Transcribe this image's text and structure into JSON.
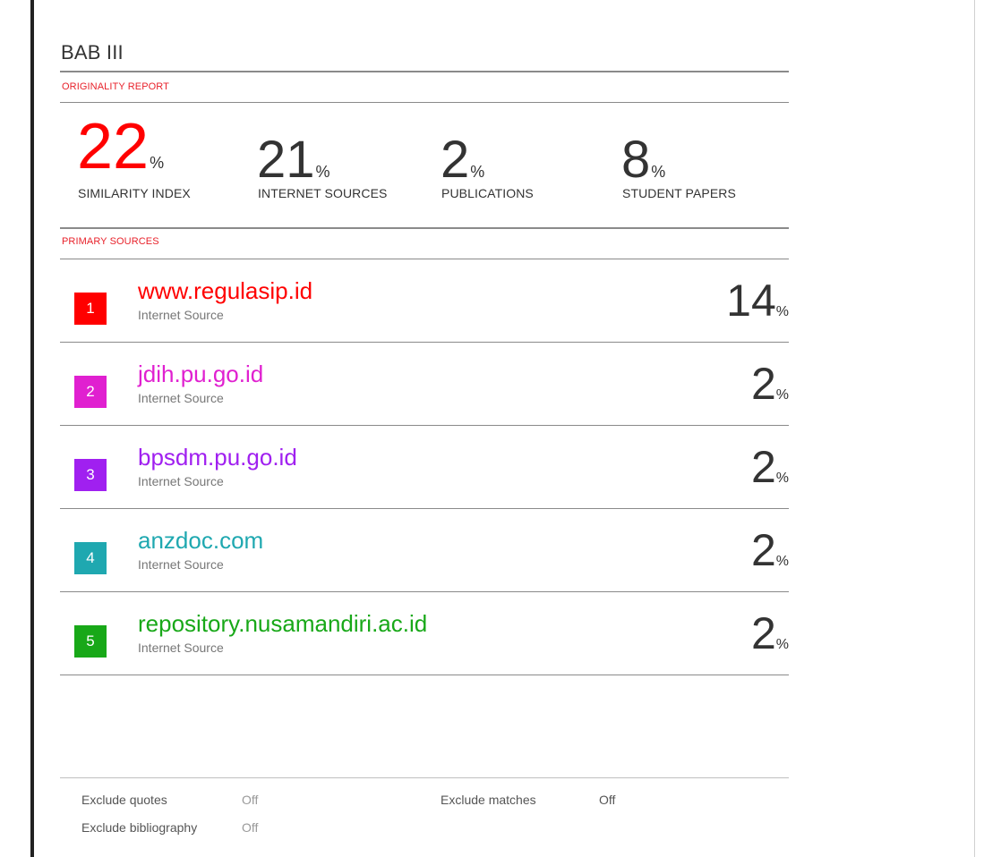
{
  "report": {
    "title": "BAB III",
    "originality_label": "ORIGINALITY REPORT",
    "primary_sources_label": "PRIMARY SOURCES"
  },
  "stats": [
    {
      "value": "22",
      "unit": "%",
      "label": "SIMILARITY INDEX"
    },
    {
      "value": "21",
      "unit": "%",
      "label": "INTERNET SOURCES"
    },
    {
      "value": "2",
      "unit": "%",
      "label": "PUBLICATIONS"
    },
    {
      "value": "8",
      "unit": "%",
      "label": "STUDENT PAPERS"
    }
  ],
  "sources": [
    {
      "index": "1",
      "name": "www.regulasip.id",
      "type": "Internet Source",
      "percent": "14",
      "unit": "%",
      "color": "#ff0000"
    },
    {
      "index": "2",
      "name": "jdih.pu.go.id",
      "type": "Internet Source",
      "percent": "2",
      "unit": "%",
      "color": "#e020d0"
    },
    {
      "index": "3",
      "name": "bpsdm.pu.go.id",
      "type": "Internet Source",
      "percent": "2",
      "unit": "%",
      "color": "#a020f0"
    },
    {
      "index": "4",
      "name": "anzdoc.com",
      "type": "Internet Source",
      "percent": "2",
      "unit": "%",
      "color": "#1fa8b0"
    },
    {
      "index": "5",
      "name": "repository.nusamandiri.ac.id",
      "type": "Internet Source",
      "percent": "2",
      "unit": "%",
      "color": "#18a818"
    }
  ],
  "footer": {
    "exclude_quotes_label": "Exclude quotes",
    "exclude_quotes_value": "Off",
    "exclude_bibliography_label": "Exclude bibliography",
    "exclude_bibliography_value": "Off",
    "exclude_matches_label": "Exclude matches",
    "exclude_matches_value": "Off"
  }
}
